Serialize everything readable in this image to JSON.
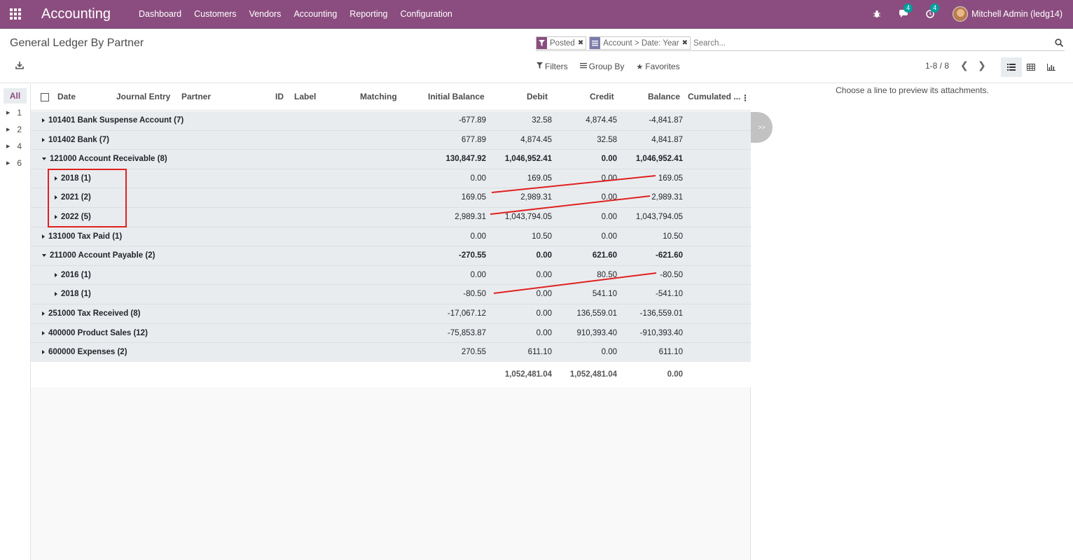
{
  "navbar": {
    "app_name": "Accounting",
    "menu": [
      "Dashboard",
      "Customers",
      "Vendors",
      "Accounting",
      "Reporting",
      "Configuration"
    ],
    "messages_count": "4",
    "activities_count": "4",
    "user": "Mitchell Admin (ledg14)",
    "bg_color": "#8b4d7f"
  },
  "control_panel": {
    "title": "General Ledger By Partner",
    "facets": [
      {
        "icon": "filter-icon",
        "label": "Posted"
      },
      {
        "icon": "groupby-icon",
        "label": "Account > Date: Year"
      }
    ],
    "search_placeholder": "Search...",
    "filters_label": "Filters",
    "groupby_label": "Group By",
    "favorites_label": "Favorites",
    "pager": "1-8 / 8"
  },
  "side_panel": {
    "all_label": "All",
    "items": [
      "1",
      "2",
      "4",
      "6"
    ]
  },
  "table": {
    "headers": {
      "date": "Date",
      "journal_entry": "Journal Entry",
      "partner": "Partner",
      "id": "ID",
      "label": "Label",
      "matching": "Matching",
      "initial_balance": "Initial Balance",
      "debit": "Debit",
      "credit": "Credit",
      "balance": "Balance",
      "cumulated": "Cumulated ..."
    },
    "rows": [
      {
        "name": "101401 Bank Suspense Account (7)",
        "level": 0,
        "open": false,
        "initial": "-677.89",
        "debit": "32.58",
        "credit": "4,874.45",
        "balance": "-4,841.87"
      },
      {
        "name": "101402 Bank (7)",
        "level": 0,
        "open": false,
        "initial": "677.89",
        "debit": "4,874.45",
        "credit": "32.58",
        "balance": "4,841.87"
      },
      {
        "name": "121000 Account Receivable (8)",
        "level": 0,
        "open": true,
        "initial": "130,847.92",
        "debit": "1,046,952.41",
        "credit": "0.00",
        "balance": "1,046,952.41"
      },
      {
        "name": "2018 (1)",
        "level": 1,
        "open": false,
        "initial": "0.00",
        "debit": "169.05",
        "credit": "0.00",
        "balance": "169.05"
      },
      {
        "name": "2021 (2)",
        "level": 1,
        "open": false,
        "initial": "169.05",
        "debit": "2,989.31",
        "credit": "0.00",
        "balance": "2,989.31"
      },
      {
        "name": "2022 (5)",
        "level": 1,
        "open": false,
        "initial": "2,989.31",
        "debit": "1,043,794.05",
        "credit": "0.00",
        "balance": "1,043,794.05"
      },
      {
        "name": "131000 Tax Paid (1)",
        "level": 0,
        "open": false,
        "initial": "0.00",
        "debit": "10.50",
        "credit": "0.00",
        "balance": "10.50"
      },
      {
        "name": "211000 Account Payable (2)",
        "level": 0,
        "open": true,
        "initial": "-270.55",
        "debit": "0.00",
        "credit": "621.60",
        "balance": "-621.60"
      },
      {
        "name": "2016 (1)",
        "level": 1,
        "open": false,
        "initial": "0.00",
        "debit": "0.00",
        "credit": "80.50",
        "balance": "-80.50"
      },
      {
        "name": "2018 (1)",
        "level": 1,
        "open": false,
        "initial": "-80.50",
        "debit": "0.00",
        "credit": "541.10",
        "balance": "-541.10"
      },
      {
        "name": "251000 Tax Received (8)",
        "level": 0,
        "open": false,
        "initial": "-17,067.12",
        "debit": "0.00",
        "credit": "136,559.01",
        "balance": "-136,559.01"
      },
      {
        "name": "400000 Product Sales (12)",
        "level": 0,
        "open": false,
        "initial": "-75,853.87",
        "debit": "0.00",
        "credit": "910,393.40",
        "balance": "-910,393.40"
      },
      {
        "name": "600000 Expenses (2)",
        "level": 0,
        "open": false,
        "initial": "270.55",
        "debit": "611.10",
        "credit": "0.00",
        "balance": "611.10"
      }
    ],
    "totals": {
      "debit": "1,052,481.04",
      "credit": "1,052,481.04",
      "balance": "0.00"
    }
  },
  "preview": {
    "message": "Choose a line to preview its attachments.",
    "toggle_label": ">>"
  },
  "annotation_color": "#e02020"
}
